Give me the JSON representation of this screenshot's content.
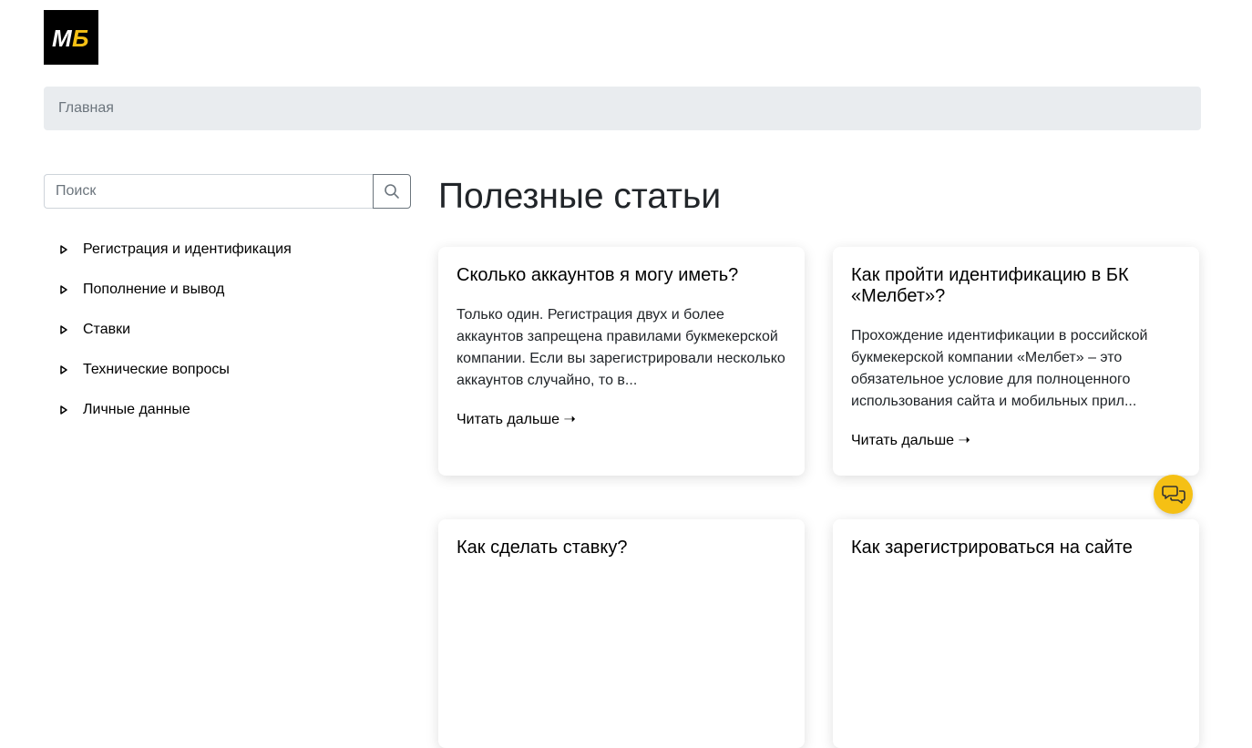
{
  "logo": {
    "text": "MБ",
    "accent": "#f5c014"
  },
  "breadcrumb": {
    "home": "Главная"
  },
  "search": {
    "placeholder": "Поиск",
    "icon": "search-icon"
  },
  "sidebar": {
    "categories": [
      {
        "label": "Регистрация и идентификация"
      },
      {
        "label": "Пополнение и вывод"
      },
      {
        "label": "Ставки"
      },
      {
        "label": "Технические вопросы"
      },
      {
        "label": "Личные данные"
      }
    ]
  },
  "main": {
    "title": "Полезные статьи",
    "articles": [
      {
        "title": "Сколько аккаунтов я могу иметь?",
        "excerpt": "Только один. Регистрация двух и более аккаунтов запрещена правилами букмекерской компании. Если вы зарегистрировали несколько аккаунтов случайно, то в...",
        "more": "Читать дальше ➝"
      },
      {
        "title": "Как пройти идентификацию в БК «Мелбет»?",
        "excerpt": "Прохождение идентификации в российской букмекерской компании «Мелбет» – это обязательное условие для полноценного использования сайта и мобильных прил...",
        "more": "Читать дальше ➝"
      },
      {
        "title": "Как сделать ставку?",
        "excerpt": "",
        "more": ""
      },
      {
        "title": "Как зарегистрироваться на сайте",
        "excerpt": "",
        "more": ""
      }
    ]
  },
  "chat": {
    "icon": "chat-icon",
    "color": "#f5c014"
  }
}
